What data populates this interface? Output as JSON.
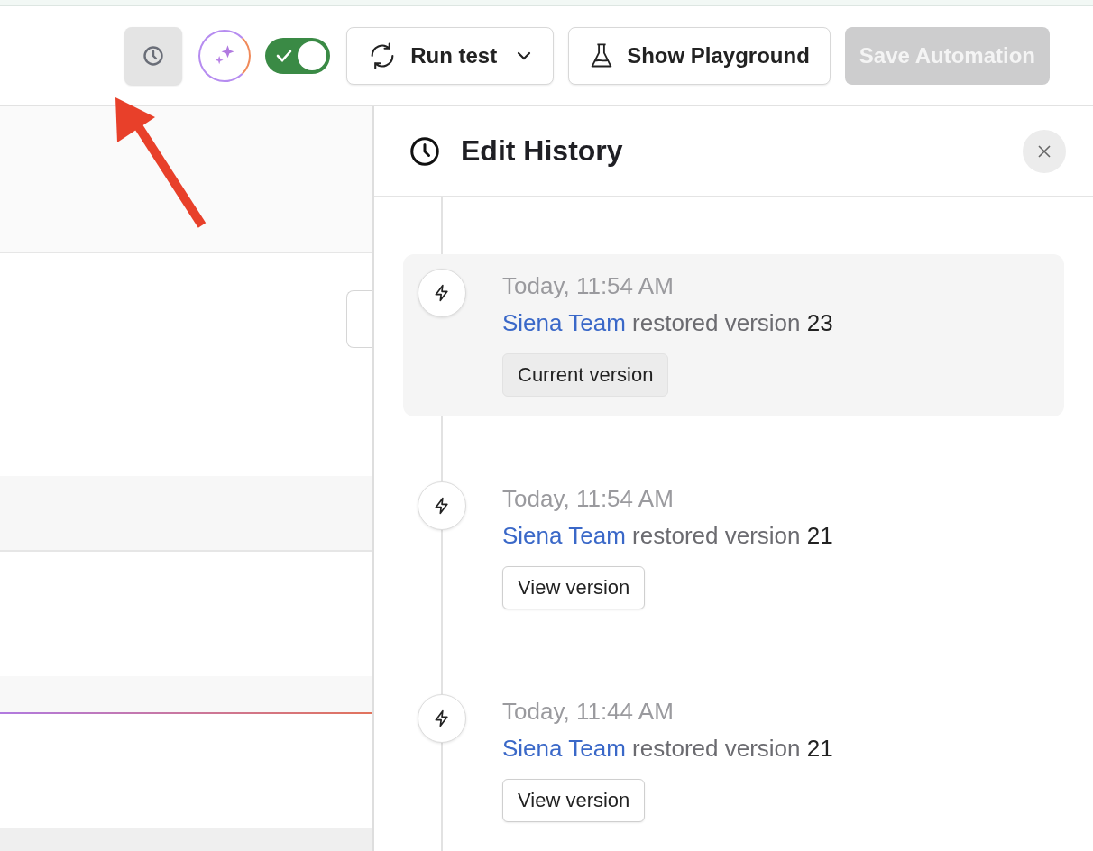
{
  "toolbar": {
    "history_button": {
      "selected": true
    },
    "automation_toggle": {
      "on": true
    },
    "run_test": {
      "label": "Run test"
    },
    "show_playground": {
      "label": "Show Playground"
    },
    "save_automation": {
      "label": "Save Automation",
      "disabled": true
    }
  },
  "edit_history": {
    "title": "Edit History",
    "entries": [
      {
        "time": "Today, 11:54 AM",
        "user": "Siena Team",
        "action": "restored version",
        "version": "23",
        "current": true,
        "button": {
          "label": "Current version",
          "kind": "current"
        }
      },
      {
        "time": "Today, 11:54 AM",
        "user": "Siena Team",
        "action": "restored version",
        "version": "21",
        "current": false,
        "button": {
          "label": "View version",
          "kind": "view"
        }
      },
      {
        "time": "Today, 11:44 AM",
        "user": "Siena Team",
        "action": "restored version",
        "version": "21",
        "current": false,
        "button": {
          "label": "View version",
          "kind": "view"
        }
      }
    ]
  }
}
